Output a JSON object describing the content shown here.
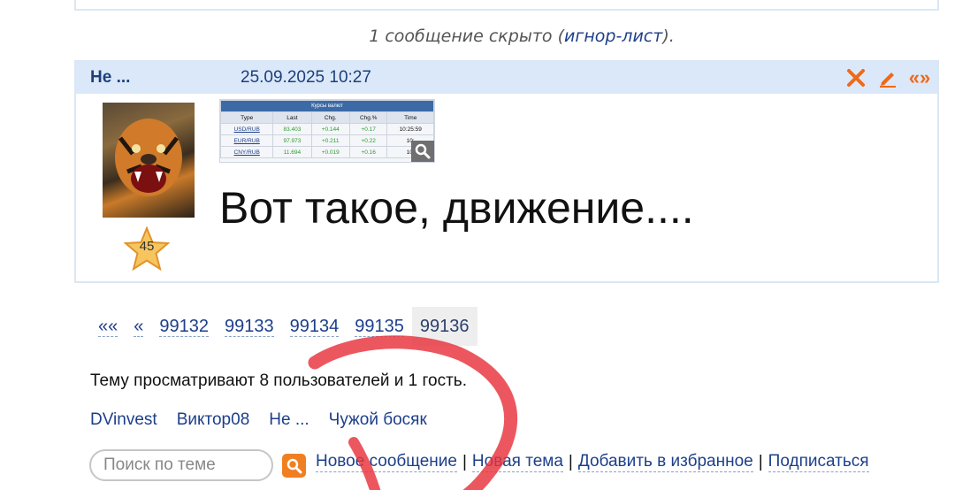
{
  "hidden_notice": {
    "prefix": "1 сообщение скрыто (",
    "link": "игнор-лист",
    "suffix": ")."
  },
  "post": {
    "author": "Не ...",
    "date": "25.09.2025 10:27",
    "rating": "45",
    "text": "Вот такое, движение....",
    "header_icons": [
      "close-x-icon",
      "edit-pencil-icon",
      "quote-icon"
    ],
    "quote_glyph": "«»",
    "attachment": {
      "title": "Курсы валют",
      "columns": [
        "Type",
        "Last",
        "Chg.",
        "Chg.%",
        "Time"
      ],
      "rows": [
        [
          "USD/RUB",
          "83.403",
          "+0.144",
          "+0.17",
          "10:25:59"
        ],
        [
          "EUR/RUB",
          "97.973",
          "+0.211",
          "+0.22",
          "10:"
        ],
        [
          "CNY/RUB",
          "11.694",
          "+0.019",
          "+0.16",
          "10:"
        ]
      ]
    }
  },
  "pager": {
    "first": "««",
    "prev": "«",
    "pages": [
      "99132",
      "99133",
      "99134",
      "99135"
    ],
    "current": "99136"
  },
  "viewers_text": "Тему просматривают 8 пользователей и 1 гость.",
  "users": [
    "DVinvest",
    "Виктор08",
    "Не ...",
    "Чужой босяк"
  ],
  "search": {
    "placeholder": "Поиск по теме"
  },
  "actions": [
    "Новое сообщение",
    "Новая тема",
    "Добавить в избранное",
    "Подписаться"
  ],
  "colors": {
    "link": "#1d3f8a",
    "header_bg": "#dbe8f9",
    "accent": "#ee6a1a",
    "annotation": "#e8323c"
  }
}
